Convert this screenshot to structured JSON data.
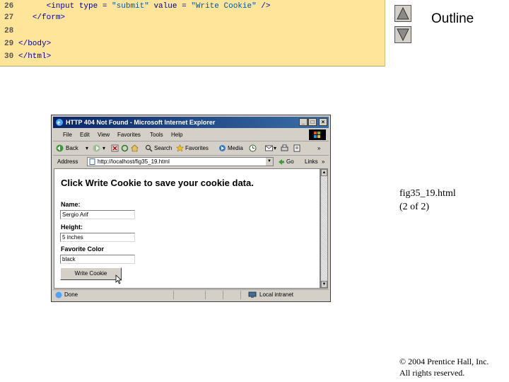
{
  "code": {
    "lines": [
      {
        "num": "26",
        "indent": "      ",
        "parts": [
          [
            "tag",
            "<input "
          ],
          [
            "txt",
            "type = "
          ],
          [
            "str",
            "\"submit\""
          ],
          [
            "txt",
            " value = "
          ],
          [
            "str",
            "\"Write Cookie\""
          ],
          [
            "tag",
            " />"
          ]
        ]
      },
      {
        "num": "27",
        "indent": "   ",
        "parts": [
          [
            "tag",
            "</form>"
          ]
        ]
      },
      {
        "num": "28",
        "indent": "",
        "parts": []
      },
      {
        "num": "29",
        "indent": "",
        "parts": [
          [
            "tag",
            "</body>"
          ]
        ]
      },
      {
        "num": "30",
        "indent": "",
        "parts": [
          [
            "tag",
            "</html>"
          ]
        ]
      }
    ]
  },
  "outline": {
    "title": "Outline",
    "up_icon": "triangle-up-icon",
    "down_icon": "triangle-down-icon"
  },
  "browser": {
    "title": "HTTP 404 Not Found - Microsoft Internet Explorer",
    "win_buttons": [
      "_",
      "□",
      "×"
    ],
    "menu": [
      "File",
      "Edit",
      "View",
      "Favorites",
      "Tools",
      "Help"
    ],
    "toolbar": {
      "back": "Back",
      "search": "Search",
      "favorites": "Favorites",
      "media": "Media"
    },
    "address_label": "Address",
    "address_value": "http://localhost/fig35_19.html",
    "go_label": "Go",
    "links_label": "Links",
    "status_text": "Done",
    "zone_text": "Local intranet"
  },
  "page": {
    "heading": "Click Write Cookie to save your cookie data.",
    "name_label": "Name:",
    "name_value": "Sergio Arif",
    "height_label": "Height:",
    "height_value": "5 inches",
    "color_label": "Favorite Color",
    "color_value": "black",
    "submit_label": "Write Cookie"
  },
  "file_label": [
    "fig35_19.html",
    "(2 of 2)"
  ],
  "copyright": [
    "© 2004 Prentice Hall, Inc.",
    "All rights reserved."
  ],
  "colors": {
    "code_bg": "#ffe599",
    "title_bar": "#0a246a"
  }
}
